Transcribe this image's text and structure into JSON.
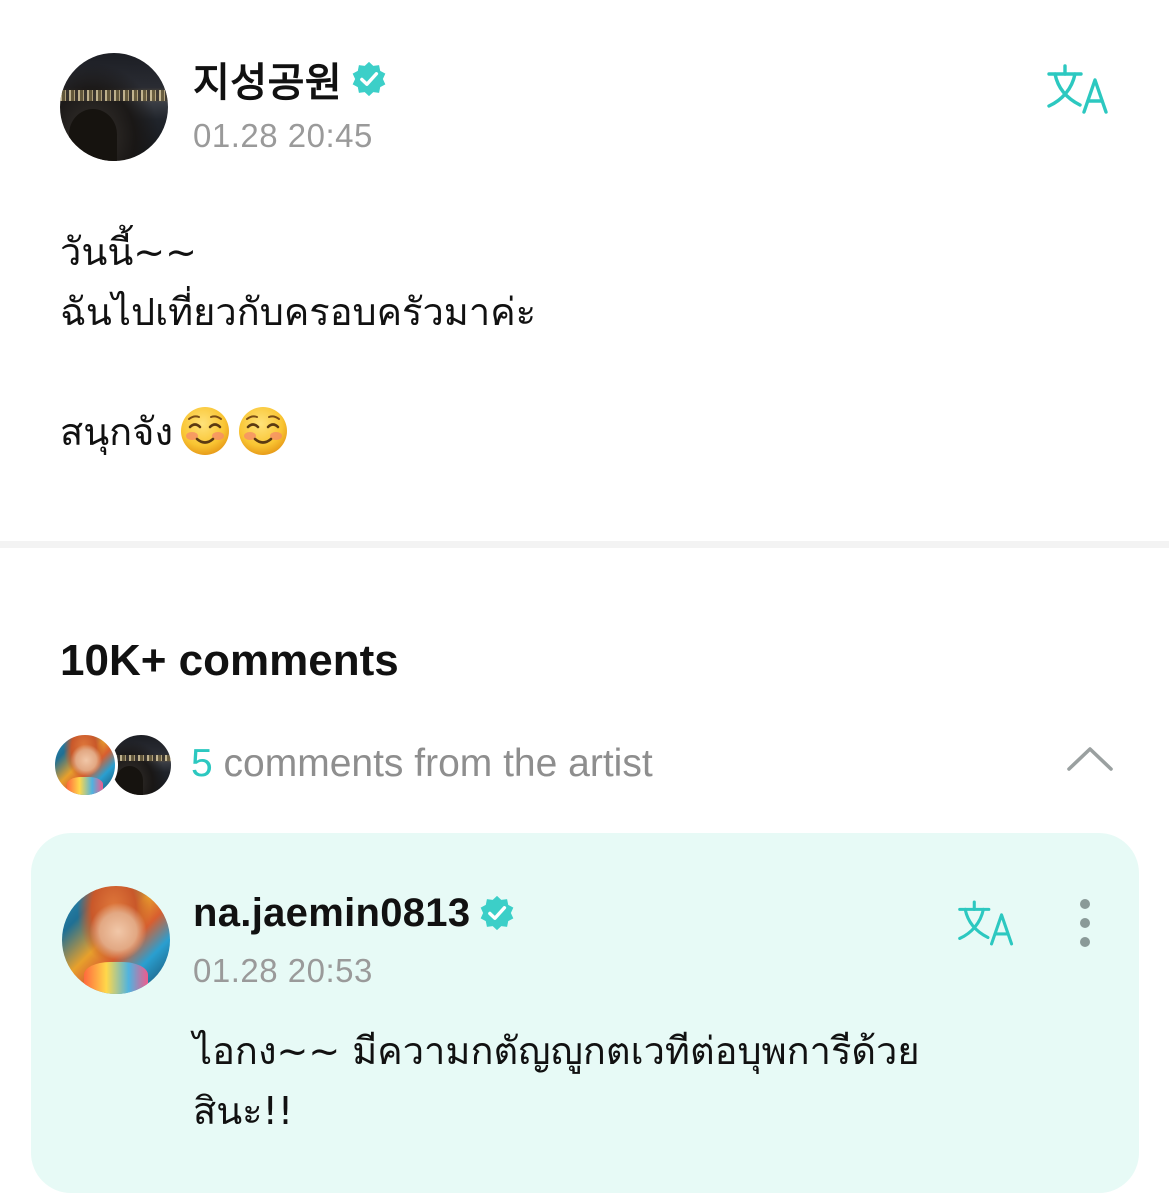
{
  "post": {
    "author": "지성공원",
    "timestamp": "01.28 20:45",
    "lines": [
      "วันนี้~~",
      "ฉันไปเที่ยวกับครอบครัวมาค่ะ",
      "",
      "สนุกจัง"
    ],
    "emojis": [
      "smiling-face-icon",
      "smiling-face-icon"
    ]
  },
  "icons": {
    "verified": "verified-badge-icon",
    "translate": "translate-icon",
    "chevron": "chevron-up-icon",
    "more": "more-vertical-icon"
  },
  "colors": {
    "accent": "#2cc8c0",
    "verified": "#3ccfc8",
    "card_background": "#e7faf6",
    "muted_text": "#9a9a9a"
  },
  "comments": {
    "title": "10K+ comments",
    "artist_count": "5",
    "artist_label": "comments from the artist",
    "items": [
      {
        "author": "na.jaemin0813",
        "timestamp": "01.28 20:53",
        "text_line1": "ไอกง~~ มีความกตัญญูกตเวทีต่อบุพการีด้วย",
        "text_line2": "สินะ!!"
      }
    ]
  }
}
